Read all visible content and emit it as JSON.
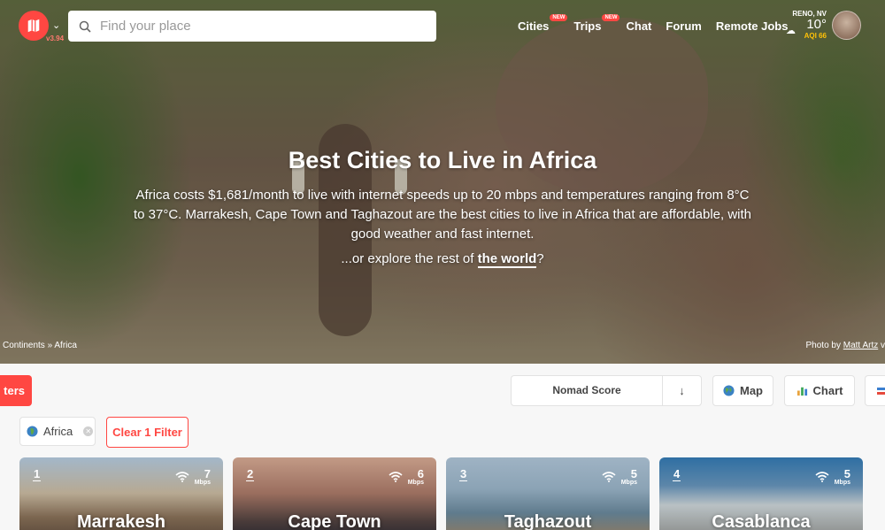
{
  "header": {
    "version": "v3.94",
    "search_placeholder": "Find your place",
    "nav": [
      {
        "label": "Cities",
        "badge": "NEW"
      },
      {
        "label": "Trips",
        "badge": "NEW"
      },
      {
        "label": "Chat"
      },
      {
        "label": "Forum"
      },
      {
        "label": "Remote Jobs"
      }
    ],
    "weather": {
      "city": "RENO, NV",
      "temp": "10°",
      "aqi_label": "AQI",
      "aqi_value": "66"
    }
  },
  "hero": {
    "title": "Best Cities to Live in Africa",
    "description": "Africa costs $1,681/month to live with internet speeds up to 20 mbps and temperatures ranging from 8°C to 37°C. Marrakesh, Cape Town and Taghazout are the best cities to live in Africa that are affordable, with good weather and fast internet.",
    "explore_prefix": "...or explore the rest of ",
    "explore_link": "the world",
    "explore_suffix": "?",
    "breadcrumb": "Continents » Africa",
    "photo_credit_prefix": "Photo by ",
    "photo_credit_author": "Matt Artz",
    "photo_credit_suffix": " v"
  },
  "toolbar": {
    "filters_label": "ters",
    "sort_label": "Nomad Score",
    "sort_direction": "↓",
    "map_label": "Map",
    "chart_label": "Chart",
    "filter_chip": "Africa",
    "clear_filter_label": "Clear 1 Filter"
  },
  "cities": [
    {
      "rank": "1",
      "name": "Marrakesh",
      "speed": "7",
      "unit": "Mbps"
    },
    {
      "rank": "2",
      "name": "Cape Town",
      "speed": "6",
      "unit": "Mbps"
    },
    {
      "rank": "3",
      "name": "Taghazout",
      "speed": "5",
      "unit": "Mbps"
    },
    {
      "rank": "4",
      "name": "Casablanca",
      "speed": "5",
      "unit": "Mbps"
    }
  ]
}
